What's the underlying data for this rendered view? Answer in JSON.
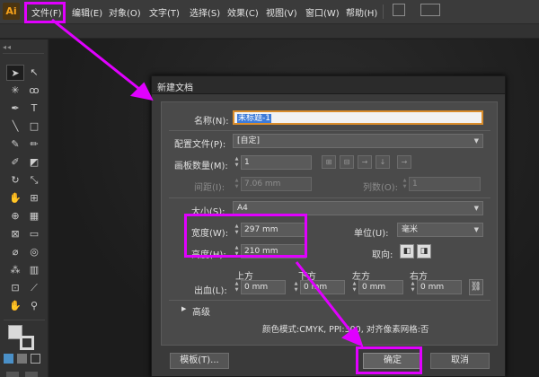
{
  "app": {
    "logo": "Ai",
    "menu": [
      {
        "label": "文件(F)",
        "name": "menu-file"
      },
      {
        "label": "编辑(E)",
        "name": "menu-edit"
      },
      {
        "label": "对象(O)",
        "name": "menu-object"
      },
      {
        "label": "文字(T)",
        "name": "menu-type"
      },
      {
        "label": "选择(S)",
        "name": "menu-select"
      },
      {
        "label": "效果(C)",
        "name": "menu-effect"
      },
      {
        "label": "视图(V)",
        "name": "menu-view"
      },
      {
        "label": "窗口(W)",
        "name": "menu-window"
      },
      {
        "label": "帮助(H)",
        "name": "menu-help"
      }
    ],
    "collapse_glyph": "◂◂"
  },
  "dialog": {
    "title": "新建文档",
    "name_label": "名称(N):",
    "name_value": "未标题-1",
    "profile_label": "配置文件(P):",
    "profile_value": "[自定]",
    "artboards_label": "画板数量(M):",
    "artboards_value": "1",
    "spacing_label": "间距(I):",
    "spacing_value": "7.06 mm",
    "columns_label": "列数(O):",
    "columns_value": "1",
    "size_label": "大小(S):",
    "size_value": "A4",
    "width_label": "宽度(W):",
    "width_value": "297 mm",
    "units_label": "单位(U):",
    "units_value": "毫米",
    "height_label": "高度(H):",
    "height_value": "210 mm",
    "orientation_label": "取向:",
    "bleed_label": "出血(L):",
    "bleed_headers": [
      "上方",
      "下方",
      "左方",
      "右方"
    ],
    "bleed_values": [
      "0 mm",
      "0 mm",
      "0 mm",
      "0 mm"
    ],
    "advanced_label": "高级",
    "color_mode_text": "颜色模式:CMYK, PPI:300, 对齐像素网格:否",
    "template_button": "模板(T)...",
    "ok_button": "确定",
    "cancel_button": "取消"
  },
  "annotation_color": "#e000ff"
}
